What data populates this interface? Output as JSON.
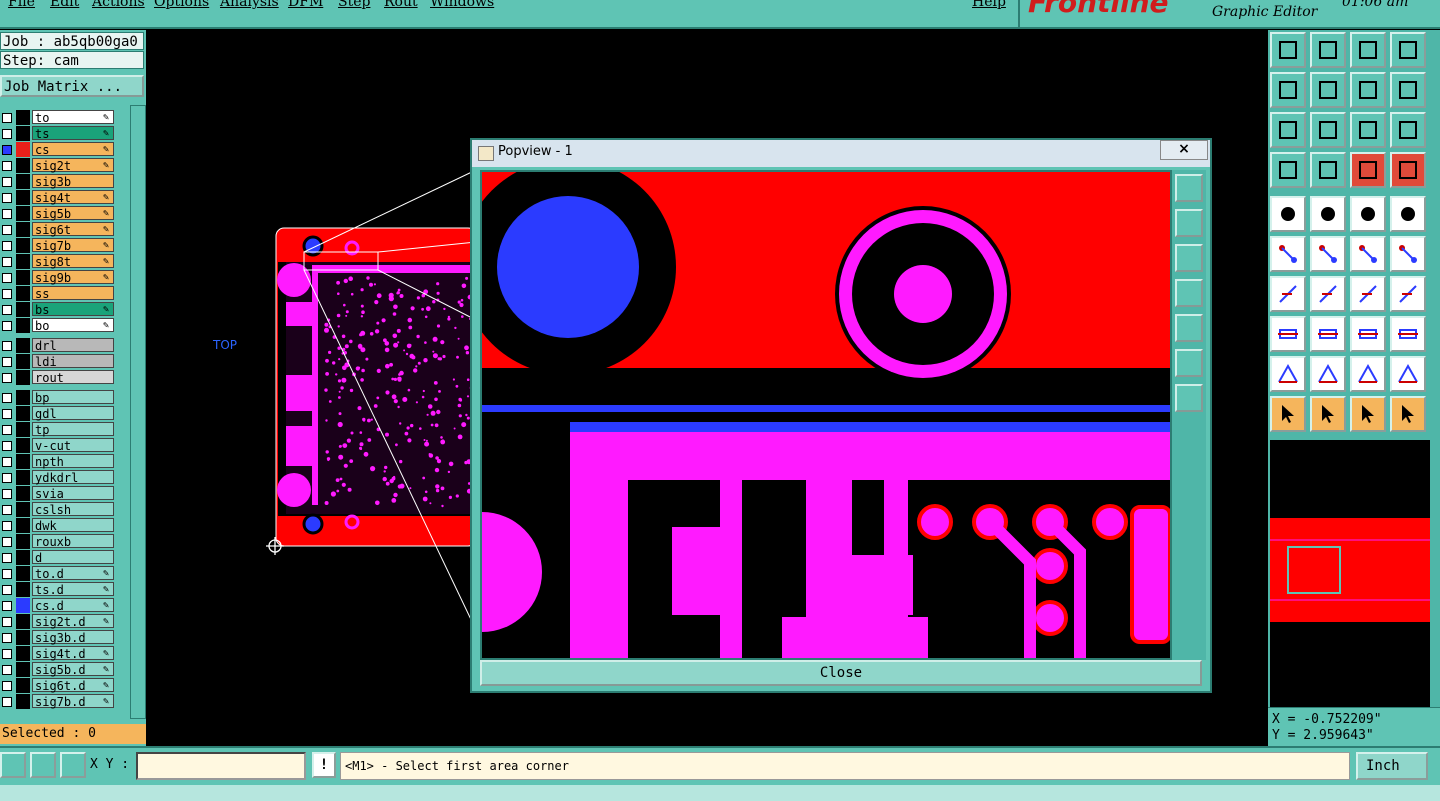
{
  "menu": [
    "File",
    "Edit",
    "Actions",
    "Options",
    "Analysis",
    "DFM",
    "Step",
    "Rout",
    "Windows",
    "Help"
  ],
  "logo": {
    "brand": "Frontline",
    "subtitle": "Graphic Editor",
    "time": "01:06 am"
  },
  "job": {
    "job_label": "Job : ab5qb00ga0",
    "step_label": "Step: cam",
    "matrix_label": "Job Matrix ..."
  },
  "layers": [
    {
      "name": "to",
      "color": "#ffffff",
      "swatch": "#000000",
      "editable": true
    },
    {
      "name": "ts",
      "color": "#1aa37a",
      "swatch": "#000000",
      "editable": true
    },
    {
      "name": "cs",
      "color": "#f5b55c",
      "swatch": "#e8201a",
      "editable": true,
      "selected": true
    },
    {
      "name": "sig2t",
      "color": "#f5b55c",
      "swatch": "#000000",
      "editable": true
    },
    {
      "name": "sig3b",
      "color": "#f5b55c",
      "swatch": "#000000",
      "editable": false
    },
    {
      "name": "sig4t",
      "color": "#f5b55c",
      "swatch": "#000000",
      "editable": true
    },
    {
      "name": "sig5b",
      "color": "#f5b55c",
      "swatch": "#000000",
      "editable": true
    },
    {
      "name": "sig6t",
      "color": "#f5b55c",
      "swatch": "#000000",
      "editable": true
    },
    {
      "name": "sig7b",
      "color": "#f5b55c",
      "swatch": "#000000",
      "editable": true
    },
    {
      "name": "sig8t",
      "color": "#f5b55c",
      "swatch": "#000000",
      "editable": true
    },
    {
      "name": "sig9b",
      "color": "#f5b55c",
      "swatch": "#000000",
      "editable": true
    },
    {
      "name": "ss",
      "color": "#f5b55c",
      "swatch": "#000000",
      "editable": false
    },
    {
      "name": "bs",
      "color": "#1aa37a",
      "swatch": "#000000",
      "editable": true
    },
    {
      "name": "bo",
      "color": "#ffffff",
      "swatch": "#000000",
      "editable": true
    },
    {
      "name": "drl",
      "color": "#b8b8b8",
      "swatch": "#000000",
      "editable": false
    },
    {
      "name": "ldi",
      "color": "#b8b8b8",
      "swatch": "#000000",
      "editable": false
    },
    {
      "name": "rout",
      "color": "#d6d6d6",
      "swatch": "#000000",
      "editable": false
    },
    {
      "name": "bp",
      "color": "#8fd6ca",
      "swatch": "#000000",
      "editable": false
    },
    {
      "name": "gdl",
      "color": "#8fd6ca",
      "swatch": "#000000",
      "editable": false
    },
    {
      "name": "tp",
      "color": "#8fd6ca",
      "swatch": "#000000",
      "editable": false
    },
    {
      "name": "v-cut",
      "color": "#8fd6ca",
      "swatch": "#000000",
      "editable": false
    },
    {
      "name": "npth",
      "color": "#8fd6ca",
      "swatch": "#000000",
      "editable": false
    },
    {
      "name": "ydkdrl",
      "color": "#8fd6ca",
      "swatch": "#000000",
      "editable": false
    },
    {
      "name": "svia",
      "color": "#8fd6ca",
      "swatch": "#000000",
      "editable": false
    },
    {
      "name": "cslsh",
      "color": "#8fd6ca",
      "swatch": "#000000",
      "editable": false
    },
    {
      "name": "dwk",
      "color": "#8fd6ca",
      "swatch": "#000000",
      "editable": false
    },
    {
      "name": "rouxb",
      "color": "#8fd6ca",
      "swatch": "#000000",
      "editable": false
    },
    {
      "name": "d",
      "color": "#8fd6ca",
      "swatch": "#000000",
      "editable": false
    },
    {
      "name": "to.d",
      "color": "#8fd6ca",
      "swatch": "#000000",
      "editable": true
    },
    {
      "name": "ts.d",
      "color": "#8fd6ca",
      "swatch": "#000000",
      "editable": true
    },
    {
      "name": "cs.d",
      "color": "#8fd6ca",
      "swatch": "#2b3bff",
      "editable": true
    },
    {
      "name": "sig2t.d",
      "color": "#8fd6ca",
      "swatch": "#000000",
      "editable": true
    },
    {
      "name": "sig3b.d",
      "color": "#8fd6ca",
      "swatch": "#000000",
      "editable": false
    },
    {
      "name": "sig4t.d",
      "color": "#8fd6ca",
      "swatch": "#000000",
      "editable": true
    },
    {
      "name": "sig5b.d",
      "color": "#8fd6ca",
      "swatch": "#000000",
      "editable": true
    },
    {
      "name": "sig6t.d",
      "color": "#8fd6ca",
      "swatch": "#000000",
      "editable": true
    },
    {
      "name": "sig7b.d",
      "color": "#8fd6ca",
      "swatch": "#000000",
      "editable": true
    }
  ],
  "selected_label": "Selected : 0",
  "canvas": {
    "side_label": "TOP"
  },
  "popview": {
    "title": "Popview - 1",
    "close_x": "×",
    "close_label": "Close"
  },
  "coords": {
    "x": "X = -0.752209\"",
    "y": "Y = 2.959643\""
  },
  "status": {
    "xy_label": "X Y :",
    "xy_value": "",
    "bang": "!",
    "prompt": "<M1> - Select first area corner",
    "unit": "Inch"
  },
  "colors": {
    "panel": "#5fc4b4",
    "board_red": "#ff0000",
    "pad_magenta": "#ff1aff",
    "drill_blue": "#2b3bff"
  }
}
